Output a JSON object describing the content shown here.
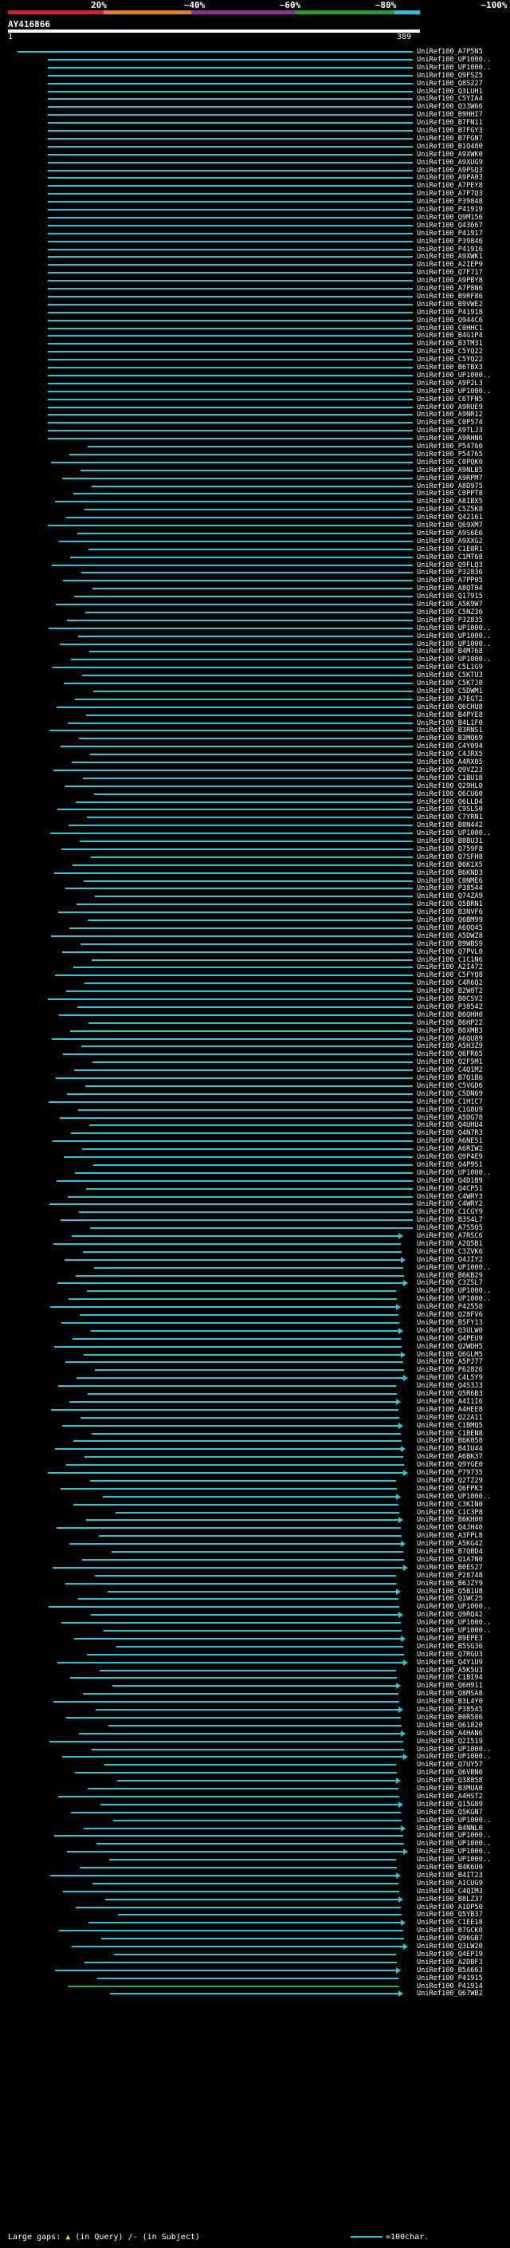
{
  "scale": {
    "labels": [
      "20%",
      "~40%",
      "~60%",
      "~80%",
      "~100%"
    ],
    "band_colors": [
      "#e8152b",
      "#f17b12",
      "#9b23a6",
      "#1fa31f",
      "#16c7e8"
    ]
  },
  "query": {
    "name": "AY416866",
    "start": "1",
    "end": "389"
  },
  "hits": [
    "UniRef100_A7P5N5",
    "UniRef100_UP1000..",
    "UniRef100_UP1000..",
    "UniRef100_Q9FSZ5",
    "UniRef100_Q8S227",
    "UniRef100_Q3LUH1",
    "UniRef100_C5YIA4",
    "UniRef100_Q33W66",
    "UniRef100_B9HHI7",
    "UniRef100_B7FN11",
    "UniRef100_B7FGY3",
    "UniRef100_B7FGN7",
    "UniRef100_B1Q480",
    "UniRef100_A9XWK0",
    "UniRef100_A9XUG9",
    "UniRef100_A9PSQ3",
    "UniRef100_A9PA03",
    "UniRef100_A7PEY8",
    "UniRef100_A7P7Q3",
    "UniRef100_P39848",
    "UniRef100_P41919",
    "UniRef100_Q9M156",
    "UniRef100_Q43667",
    "UniRef100_P41917",
    "UniRef100_P39846",
    "UniRef100_P41916",
    "UniRef100_A9XWK1",
    "UniRef100_A2IEP9",
    "UniRef100_Q7F717",
    "UniRef100_A9PBY8",
    "UniRef100_A7P8N6",
    "UniRef100_B9RF86",
    "UniRef100_B9VWE2",
    "UniRef100_P41918",
    "UniRef100_Q944C6",
    "UniRef100_C0HHC1",
    "UniRef100_B4G1P4",
    "UniRef100_B3TM31",
    "UniRef100_C5YQ22",
    "UniRef100_C5YQ22",
    "UniRef100_B6TBX3",
    "UniRef100_UP1000..",
    "UniRef100_A9P2L3",
    "UniRef100_UP1000..",
    "UniRef100_C6TFN5",
    "UniRef100_A9RUE9",
    "UniRef100_A9NR12",
    "UniRef100_C0P574",
    "UniRef100_A9TLJ3",
    "UniRef100_A9RHN6",
    "UniRef100_P54766",
    "UniRef100_P54765",
    "UniRef100_C0PQK0",
    "UniRef100_A9NLB5",
    "UniRef100_A9RPM7",
    "UniRef100_A8D975",
    "UniRef100_C0PPT8",
    "UniRef100_A8IBX5",
    "UniRef100_C5Z5K8",
    "UniRef100_Q42161",
    "UniRef100_Q69XM7",
    "UniRef100_A9S6E6",
    "UniRef100_A9XXG2",
    "UniRef100_C1E8R1",
    "UniRef100_C1MT68",
    "UniRef100_Q9FLQ3",
    "UniRef100_P32836",
    "UniRef100_A7PP05",
    "UniRef100_A8QT04",
    "UniRef100_Q17915",
    "UniRef100_A5K9W7",
    "UniRef100_C5NZ36",
    "UniRef100_P32835",
    "UniRef100_UP1000..",
    "UniRef100_UP1000..",
    "UniRef100_UP1000..",
    "UniRef100_B4M768",
    "UniRef100_UP1000..",
    "UniRef100_C5L1G9",
    "UniRef100_C5KTU3",
    "UniRef100_C5K7J0",
    "UniRef100_C5DWM1",
    "UniRef100_A7EGT2",
    "UniRef100_Q6CHU8",
    "UniRef100_B4PYE8",
    "UniRef100_B4L1F0",
    "UniRef100_B3RNS1",
    "UniRef100_B3MQ69",
    "UniRef100_C4Y094",
    "UniRef100_C4JRX5",
    "UniRef100_A4RX05",
    "UniRef100_Q9VZ23",
    "UniRef100_C1BU18",
    "UniRef100_Q29HL0",
    "UniRef100_Q6CU60",
    "UniRef100_Q6LLD4",
    "UniRef100_C9SLS0",
    "UniRef100_C7YRN1",
    "UniRef100_B8N442",
    "UniRef100_UP1000..",
    "UniRef100_B8BU31",
    "UniRef100_Q759F8",
    "UniRef100_Q7SFH8",
    "UniRef100_B6K1X5",
    "UniRef100_B6KND3",
    "UniRef100_C0NME6",
    "UniRef100_P38544",
    "UniRef100_Q74ZA9",
    "UniRef100_Q5BRN1",
    "UniRef100_B3NVF6",
    "UniRef100_Q6BM99",
    "UniRef100_A6QQ45",
    "UniRef100_A5DWZ8",
    "UniRef100_B9WBS9",
    "UniRef100_Q7PVL0",
    "UniRef100_C1C1N6",
    "UniRef100_A2I472",
    "UniRef100_C5FYQ8",
    "UniRef100_C4R6Q2",
    "UniRef100_B2W8T2",
    "UniRef100_B0CSV2",
    "UniRef100_P38542",
    "UniRef100_B6QHH0",
    "UniRef100_B6HP22",
    "UniRef100_B0XMB3",
    "UniRef100_A6QU89",
    "UniRef100_A5H3Z9",
    "UniRef100_Q6FR65",
    "UniRef100_Q2F5M1",
    "UniRef100_C4Q1M2",
    "UniRef100_B7Q1B6",
    "UniRef100_C5VGD6",
    "UniRef100_C5DN69",
    "UniRef100_C1H1C7",
    "UniRef100_C1G8U9",
    "UniRef100_A5DG78",
    "UniRef100_Q4UHU4",
    "UniRef100_Q4N7R3",
    "UniRef100_A6NES1",
    "UniRef100_A6RIW2",
    "UniRef100_Q9P4E9",
    "UniRef100_Q4P9S1",
    "UniRef100_UP1000..",
    "UniRef100_Q4D1B9",
    "UniRef100_Q4CP51",
    "UniRef100_C4WRY3",
    "UniRef100_C4WRY2",
    "UniRef100_C1CGY9",
    "UniRef100_B3S4L7",
    "UniRef100_A7S5Q5",
    "UniRef100_A7RSC6",
    "UniRef100_A2Q5B1",
    "UniRef100_C3ZVK6",
    "UniRef100_Q4JIY2",
    "UniRef100_UP1000..",
    "UniRef100_B6KB29",
    "UniRef100_C3ZSL7",
    "UniRef100_UP1000..",
    "UniRef100_UP1000..",
    "UniRef100_P42558",
    "UniRef100_Q28FV6",
    "UniRef100_B5FY13",
    "UniRef100_Q3ULW0",
    "UniRef100_Q4PEU9",
    "UniRef100_Q2WDH5",
    "UniRef100_Q6GLM5",
    "UniRef100_A5PJ77",
    "UniRef100_P62826",
    "UniRef100_C4L5Y9",
    "UniRef100_Q4S3J3",
    "UniRef100_Q5R6B3",
    "UniRef100_A4I1I6",
    "UniRef100_A4HEE8",
    "UniRef100_Q22A11",
    "UniRef100_C1BMQ5",
    "UniRef100_C1BEN8",
    "UniRef100_B6K058",
    "UniRef100_B4IU44",
    "UniRef100_A6BK37",
    "UniRef100_Q9YGE0",
    "UniRef100_P79735",
    "UniRef100_Q2TZ29",
    "UniRef100_Q6FPK3",
    "UniRef100_UP1000..",
    "UniRef100_C3KIN0",
    "UniRef100_C1C3P8",
    "UniRef100_B6KH00",
    "UniRef100_Q4JH40",
    "UniRef100_A3FPL8",
    "UniRef100_A5KG42",
    "UniRef100_B7QBD4",
    "UniRef100_Q1A7N0",
    "UniRef100_B0ES27",
    "UniRef100_P28748",
    "UniRef100_B6JZY9",
    "UniRef100_Q5B1U8",
    "UniRef100_Q1WC25",
    "UniRef100_UP1000..",
    "UniRef100_Q9RQ42",
    "UniRef100_UP1000..",
    "UniRef100_UP1000..",
    "UniRef100_B9EPE3",
    "UniRef100_B5SG36",
    "UniRef100_Q7RGU3",
    "UniRef100_Q4Y1U9",
    "UniRef100_A5K5U3",
    "UniRef100_C1BI94",
    "UniRef100_Q6H911",
    "UniRef100_Q8MSA8",
    "UniRef100_B3L4Y0",
    "UniRef100_P38545",
    "UniRef100_B0R586",
    "UniRef100_Q61820",
    "UniRef100_A4HAN6",
    "UniRef100_Q2I519",
    "UniRef100_UP1000..",
    "UniRef100_UP1000..",
    "UniRef100_Q7UY57",
    "UniRef100_Q6VBN6",
    "UniRef100_Q38858",
    "UniRef100_B3MUA0",
    "UniRef100_A4HST2",
    "UniRef100_Q15G89",
    "UniRef100_Q5KGN7",
    "UniRef100_UP1000..",
    "UniRef100_B4NNL0",
    "UniRef100_UP1000..",
    "UniRef100_UP1000..",
    "UniRef100_UP1000..",
    "UniRef100_UP1000..",
    "UniRef100_B4K6U0",
    "UniRef100_B4IT23",
    "UniRef100_A1CUG9",
    "UniRef100_C4QIM3",
    "UniRef100_B8LZ37",
    "UniRef100_A1DP50",
    "UniRef100_Q5YB37",
    "UniRef100_C1EE18",
    "UniRef100_B7GCK0",
    "UniRef100_Q96GB7",
    "UniRef100_Q3LW20",
    "UniRef100_Q4EP19",
    "UniRef100_A2DBF3",
    "UniRef100_B5A663",
    "UniRef100_P41915",
    "UniRef100_P41914",
    "UniRef100_Q67WB2"
  ],
  "legend": {
    "large_gaps": "Large gaps:",
    "in_query": "(in Query)",
    "in_subject": "/- (in Subject)",
    "scale_label": "=100char."
  }
}
